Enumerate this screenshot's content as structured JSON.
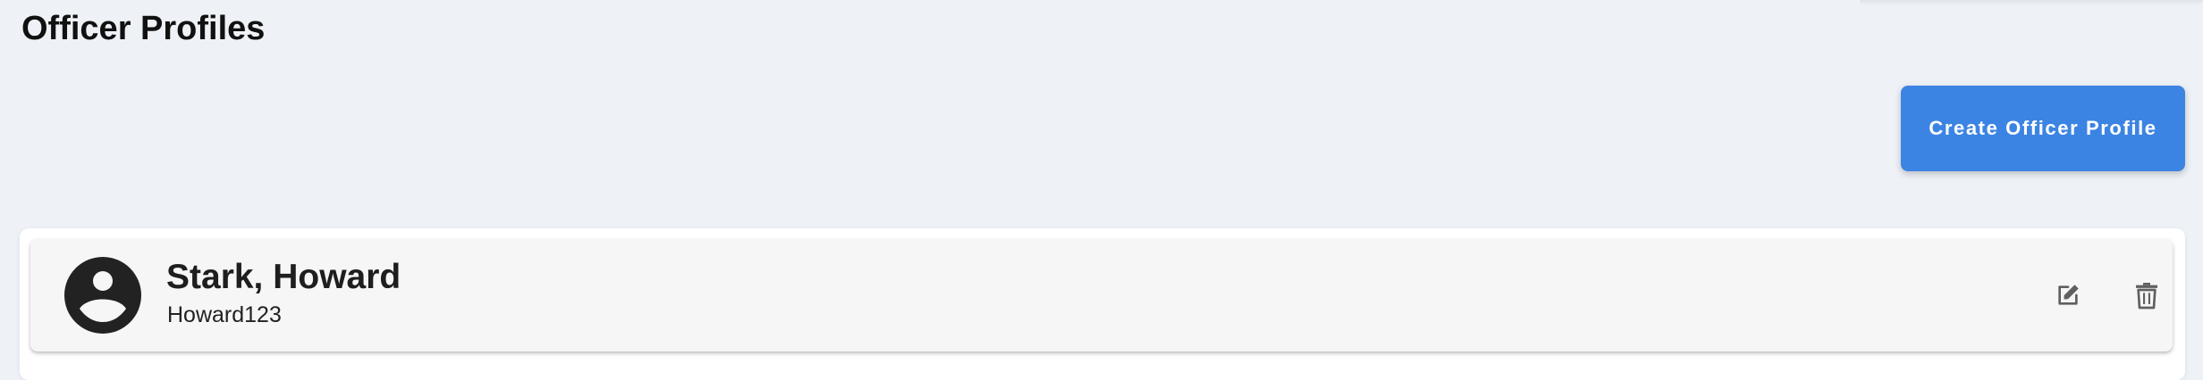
{
  "page": {
    "title": "Officer Profiles"
  },
  "actions": {
    "create_label": "Create Officer Profile"
  },
  "profiles": [
    {
      "name": "Stark, Howard",
      "username": "Howard123",
      "avatar_icon": "account-circle-icon",
      "edit_icon": "edit-icon",
      "delete_icon": "delete-icon"
    }
  ],
  "colors": {
    "background": "#eef2f7",
    "primary": "#3c84e3",
    "card": "#ffffff",
    "row": "#f6f6f6",
    "icon": "#606060",
    "avatar": "#222222"
  }
}
